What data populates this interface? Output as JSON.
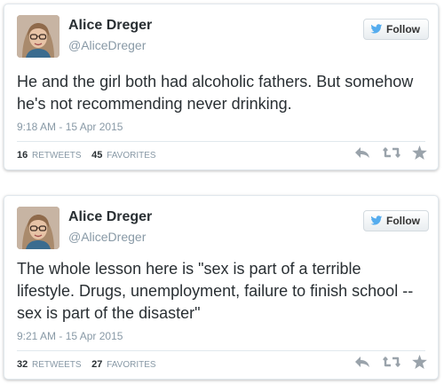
{
  "tweets": [
    {
      "name": "Alice Dreger",
      "handle": "@AliceDreger",
      "follow_label": "Follow",
      "text": "He and the girl both had alcoholic fathers. But somehow he's not recommending never drinking.",
      "timestamp": "9:18 AM - 15 Apr 2015",
      "retweets": "16",
      "retweets_label": "RETWEETS",
      "favorites": "45",
      "favorites_label": "FAVORITES"
    },
    {
      "name": "Alice Dreger",
      "handle": "@AliceDreger",
      "follow_label": "Follow",
      "text": "The whole lesson here is \"sex is part of a terrible lifestyle. Drugs, unemployment, failure to finish school -- sex is part of the disaster\"",
      "timestamp": "9:21 AM - 15 Apr 2015",
      "retweets": "32",
      "retweets_label": "RETWEETS",
      "favorites": "27",
      "favorites_label": "FAVORITES"
    }
  ],
  "icons": {
    "follow": "twitter-bird-icon",
    "reply": "reply-icon",
    "retweet": "retweet-icon",
    "favorite": "star-icon"
  },
  "colors": {
    "text": "#292f33",
    "muted": "#8899a6",
    "twitter_blue": "#55acee",
    "action_gray": "#9aa3ab"
  }
}
